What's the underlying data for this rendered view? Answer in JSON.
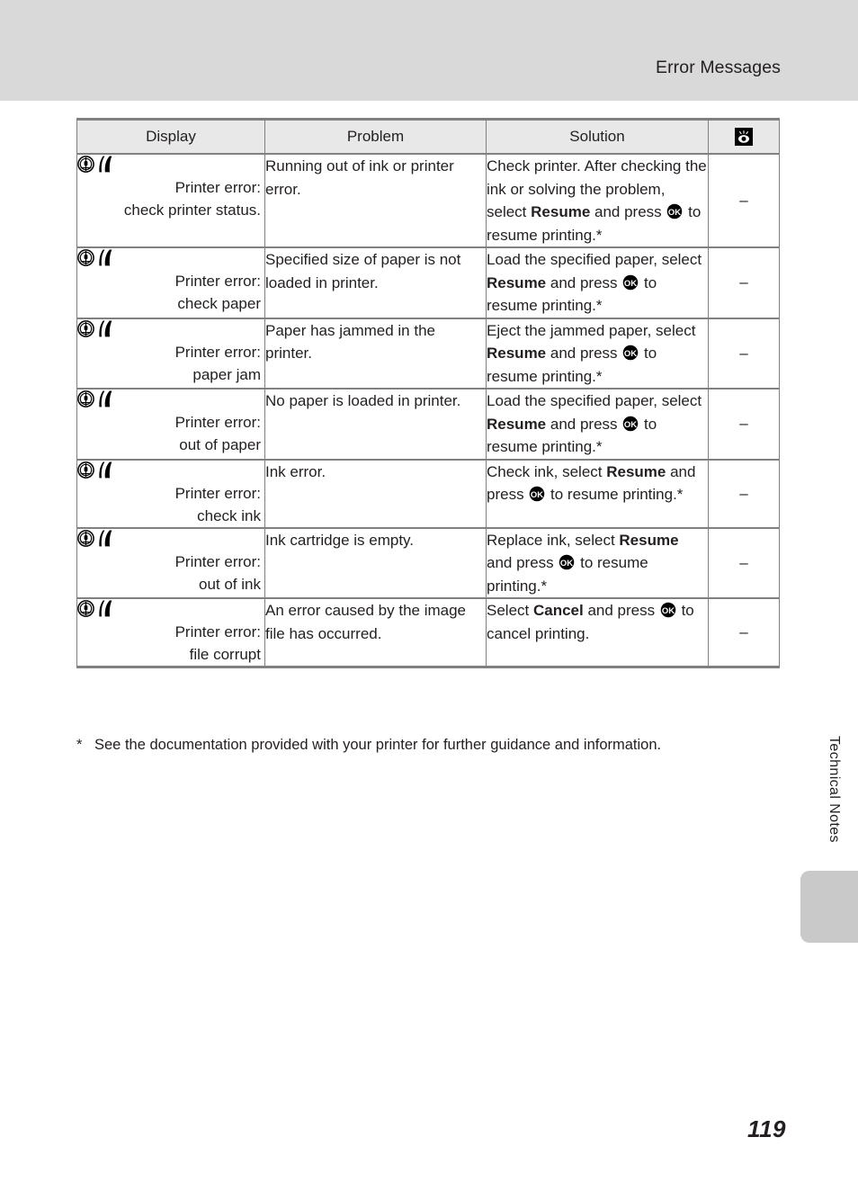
{
  "page": {
    "header_title": "Error Messages",
    "page_number": "119",
    "side_tab_label": "Technical Notes"
  },
  "table": {
    "headers": {
      "display": "Display",
      "problem": "Problem",
      "solution": "Solution",
      "reference_icon": "reference-page-icon"
    },
    "rows": [
      {
        "display_icons": [
          "printer-status-circle-icon",
          "printer-error-flame-icon"
        ],
        "display_lines": [
          "Printer error:",
          "check printer status."
        ],
        "problem": "Running out of ink or printer error.",
        "solution_parts": [
          {
            "type": "text",
            "value": "Check printer. After checking the ink or solving the problem, select "
          },
          {
            "type": "bold",
            "value": "Resume"
          },
          {
            "type": "text",
            "value": " and press "
          },
          {
            "type": "okkey",
            "value": "OK"
          },
          {
            "type": "text",
            "value": " to resume printing.*"
          }
        ],
        "reference": "–"
      },
      {
        "display_icons": [
          "printer-status-circle-icon",
          "printer-error-flame-icon"
        ],
        "display_lines": [
          "Printer error:",
          "check paper"
        ],
        "problem": "Specified size of paper is not loaded in printer.",
        "solution_parts": [
          {
            "type": "text",
            "value": "Load the specified paper, select "
          },
          {
            "type": "bold",
            "value": "Resume"
          },
          {
            "type": "text",
            "value": " and press "
          },
          {
            "type": "okkey",
            "value": "OK"
          },
          {
            "type": "text",
            "value": " to resume printing.*"
          }
        ],
        "reference": "–"
      },
      {
        "display_icons": [
          "printer-status-circle-icon",
          "printer-error-flame-icon"
        ],
        "display_lines": [
          "Printer error:",
          "paper jam"
        ],
        "problem": "Paper has jammed in the printer.",
        "solution_parts": [
          {
            "type": "text",
            "value": "Eject the jammed paper, select "
          },
          {
            "type": "bold",
            "value": "Resume"
          },
          {
            "type": "text",
            "value": " and press "
          },
          {
            "type": "okkey",
            "value": "OK"
          },
          {
            "type": "text",
            "value": " to resume printing.*"
          }
        ],
        "reference": "–"
      },
      {
        "display_icons": [
          "printer-status-circle-icon",
          "printer-error-flame-icon"
        ],
        "display_lines": [
          "Printer error:",
          "out of paper"
        ],
        "problem": "No paper is loaded in printer.",
        "solution_parts": [
          {
            "type": "text",
            "value": "Load the specified paper, select "
          },
          {
            "type": "bold",
            "value": "Resume"
          },
          {
            "type": "text",
            "value": " and press "
          },
          {
            "type": "okkey",
            "value": "OK"
          },
          {
            "type": "text",
            "value": " to resume printing.*"
          }
        ],
        "reference": "–"
      },
      {
        "display_icons": [
          "printer-status-circle-icon",
          "printer-error-flame-icon"
        ],
        "display_lines": [
          "Printer error:",
          "check ink"
        ],
        "problem": "Ink error.",
        "solution_parts": [
          {
            "type": "text",
            "value": "Check ink, select "
          },
          {
            "type": "bold",
            "value": "Resume"
          },
          {
            "type": "text",
            "value": " and press "
          },
          {
            "type": "okkey",
            "value": "OK"
          },
          {
            "type": "text",
            "value": " to resume printing.*"
          }
        ],
        "reference": "–"
      },
      {
        "display_icons": [
          "printer-status-circle-icon",
          "printer-error-flame-icon"
        ],
        "display_lines": [
          "Printer error:",
          "out of ink"
        ],
        "problem": "Ink cartridge is empty.",
        "solution_parts": [
          {
            "type": "text",
            "value": "Replace ink, select "
          },
          {
            "type": "bold",
            "value": "Resume"
          },
          {
            "type": "text",
            "value": " and press "
          },
          {
            "type": "okkey",
            "value": "OK"
          },
          {
            "type": "text",
            "value": " to resume printing.*"
          }
        ],
        "reference": "–"
      },
      {
        "display_icons": [
          "printer-status-circle-icon",
          "printer-error-flame-icon"
        ],
        "display_lines": [
          "Printer error:",
          "file corrupt"
        ],
        "problem": "An error caused by the image file has occurred.",
        "solution_parts": [
          {
            "type": "text",
            "value": "Select "
          },
          {
            "type": "bold",
            "value": "Cancel"
          },
          {
            "type": "text",
            "value": " and press "
          },
          {
            "type": "okkey",
            "value": "OK"
          },
          {
            "type": "text",
            "value": " to cancel printing."
          }
        ],
        "reference": "–"
      }
    ]
  },
  "footnote": {
    "marker": "*",
    "text": "See the documentation provided with your printer for further guidance and information."
  },
  "colors": {
    "header_band": "#d9d9d9",
    "table_header_fill": "#e8e8e8",
    "rule": "#808080",
    "side_tab": "#c9c9c9",
    "text": "#231f20"
  }
}
